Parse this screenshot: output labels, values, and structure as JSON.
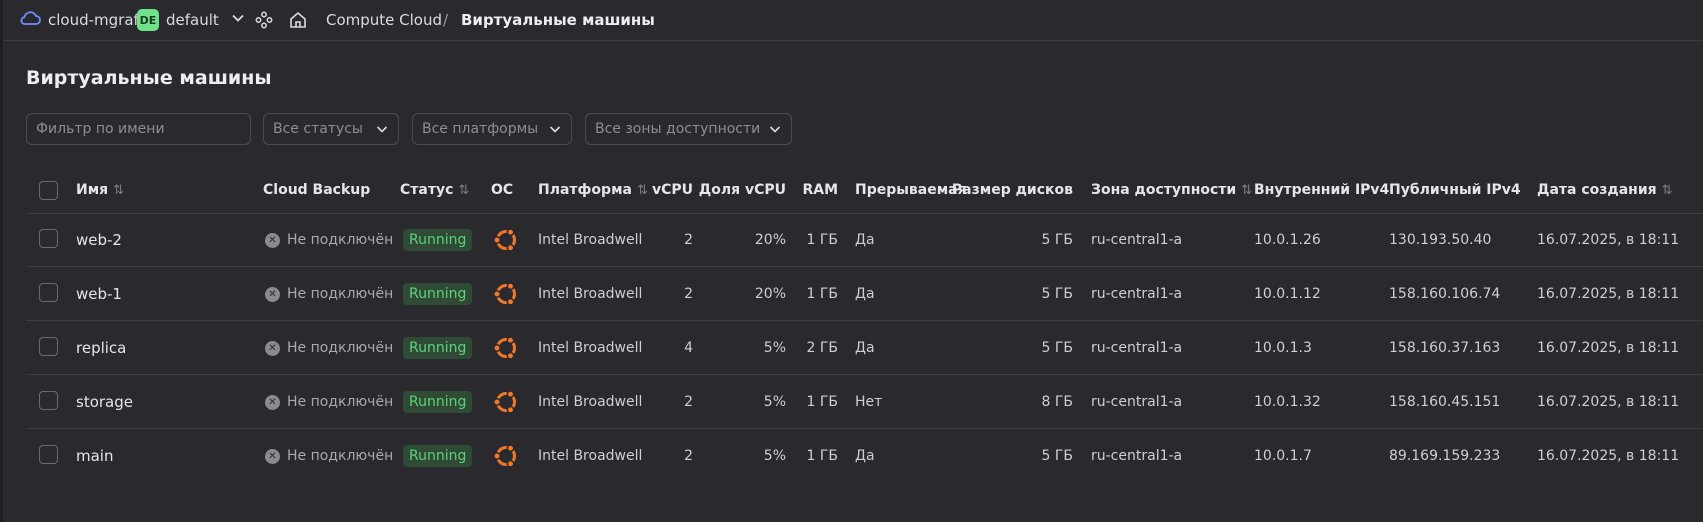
{
  "topbar": {
    "cloud_name": "cloud-mgraf",
    "folder_badge": "DE",
    "folder_name": "default",
    "service": "Compute Cloud",
    "separator": "/",
    "page": "Виртуальные машины"
  },
  "page_title": "Виртуальные машины",
  "filters": {
    "name_placeholder": "Фильтр по имени",
    "statuses": "Все статусы",
    "platforms": "Все платформы",
    "zones": "Все зоны доступности"
  },
  "table": {
    "headers": {
      "name": "Имя",
      "backup": "Cloud Backup",
      "status": "Статус",
      "os": "ОС",
      "platform": "Платформа",
      "vcpu": "vCPU",
      "vcpu_share": "Доля vCPU",
      "ram": "RAM",
      "preemptible": "Прерываемая",
      "disk_size": "Размер дисков",
      "zone": "Зона доступности",
      "internal_ip": "Внутренний IPv4",
      "public_ip": "Публичный IPv4",
      "created": "Дата создания"
    },
    "rows": [
      {
        "name": "web-2",
        "backup": "Не подключён",
        "status": "Running",
        "platform": "Intel Broadwell",
        "vcpu": "2",
        "vcpu_share": "20%",
        "ram": "1 ГБ",
        "preemptible": "Да",
        "disk_size": "5 ГБ",
        "zone": "ru-central1-a",
        "internal_ip": "10.0.1.26",
        "public_ip": "130.193.50.40",
        "created": "16.07.2025, в 18:11"
      },
      {
        "name": "web-1",
        "backup": "Не подключён",
        "status": "Running",
        "platform": "Intel Broadwell",
        "vcpu": "2",
        "vcpu_share": "20%",
        "ram": "1 ГБ",
        "preemptible": "Да",
        "disk_size": "5 ГБ",
        "zone": "ru-central1-a",
        "internal_ip": "10.0.1.12",
        "public_ip": "158.160.106.74",
        "created": "16.07.2025, в 18:11"
      },
      {
        "name": "replica",
        "backup": "Не подключён",
        "status": "Running",
        "platform": "Intel Broadwell",
        "vcpu": "4",
        "vcpu_share": "5%",
        "ram": "2 ГБ",
        "preemptible": "Да",
        "disk_size": "5 ГБ",
        "zone": "ru-central1-a",
        "internal_ip": "10.0.1.3",
        "public_ip": "158.160.37.163",
        "created": "16.07.2025, в 18:11"
      },
      {
        "name": "storage",
        "backup": "Не подключён",
        "status": "Running",
        "platform": "Intel Broadwell",
        "vcpu": "2",
        "vcpu_share": "5%",
        "ram": "1 ГБ",
        "preemptible": "Нет",
        "disk_size": "8 ГБ",
        "zone": "ru-central1-a",
        "internal_ip": "10.0.1.32",
        "public_ip": "158.160.45.151",
        "created": "16.07.2025, в 18:11"
      },
      {
        "name": "main",
        "backup": "Не подключён",
        "status": "Running",
        "platform": "Intel Broadwell",
        "vcpu": "2",
        "vcpu_share": "5%",
        "ram": "1 ГБ",
        "preemptible": "Да",
        "disk_size": "5 ГБ",
        "zone": "ru-central1-a",
        "internal_ip": "10.0.1.7",
        "public_ip": "89.169.159.233",
        "created": "16.07.2025, в 18:11"
      }
    ]
  }
}
